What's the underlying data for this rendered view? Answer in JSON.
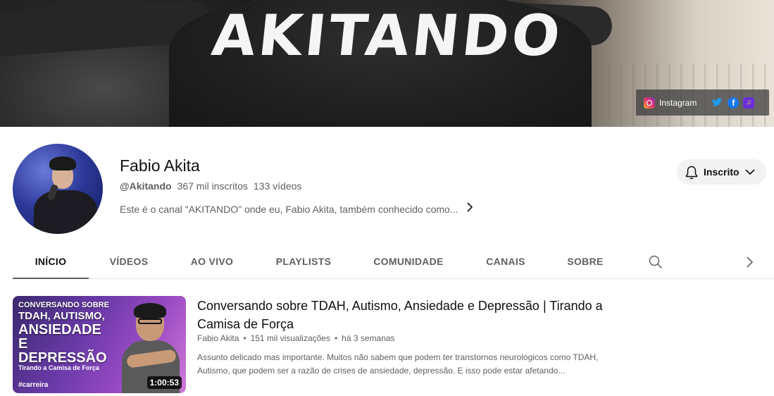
{
  "banner": {
    "brand_text": "AKITANDO",
    "links": {
      "instagram_label": "Instagram",
      "icons": [
        "instagram-icon",
        "twitter-icon",
        "facebook-icon",
        "podcast-icon"
      ]
    }
  },
  "channel": {
    "name": "Fabio Akita",
    "handle": "@Akitando",
    "subscribers": "367 mil inscritos",
    "videos": "133 vídeos",
    "description": "Este é o canal \"AKITANDO\" onde eu, Fabio Akita, também conhecido como...",
    "subscribe_label": "Inscrito"
  },
  "tabs": [
    {
      "label": "INÍCIO",
      "active": true
    },
    {
      "label": "VÍDEOS"
    },
    {
      "label": "AO VIVO"
    },
    {
      "label": "PLAYLISTS"
    },
    {
      "label": "COMUNIDADE"
    },
    {
      "label": "CANAIS"
    },
    {
      "label": "SOBRE"
    }
  ],
  "featured": {
    "thumb": {
      "line1": "CONVERSANDO SOBRE",
      "line2": "TDAH, AUTISMO,",
      "line3": "ANSIEDADE",
      "line4": "E DEPRESSÃO",
      "subtitle": "Tirando a Camisa de Força",
      "tag": "#carreira",
      "duration": "1:00:53"
    },
    "title": "Conversando sobre TDAH, Autismo, Ansiedade e Depressão | Tirando a Camisa de Força",
    "author": "Fabio Akita",
    "views": "151 mil visualizações",
    "age": "há 3 semanas",
    "description": "Assunto delicado mas importante. Muitos não sabem que podem ter transtornos neurológicos como TDAH, Autismo, que podem ser a razão de crises de ansiedade, depressão. E isso pode estar afetando..."
  },
  "colors": {
    "text_primary": "#0f0f0f",
    "text_secondary": "#606060",
    "button_bg": "#f2f2f2",
    "tab_border": "#e5e5e5"
  }
}
